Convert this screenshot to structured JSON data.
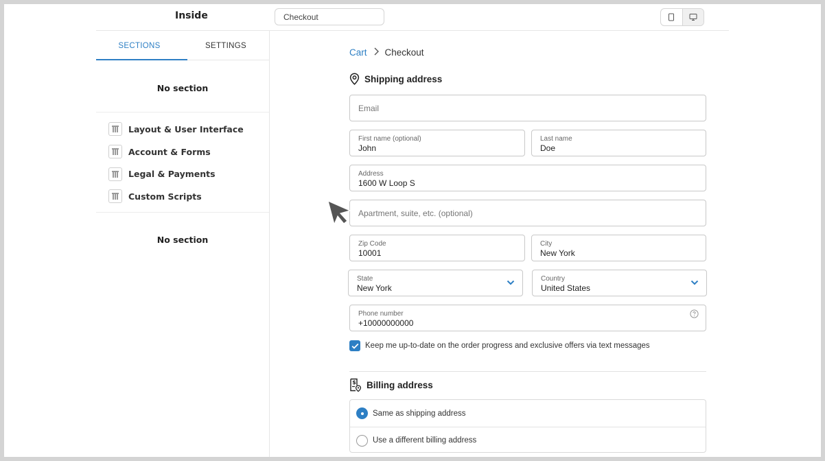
{
  "app": {
    "title": "Inside"
  },
  "page_selector": {
    "value": "Checkout"
  },
  "device_toggle": {
    "options": [
      "tablet-icon",
      "desktop-icon"
    ],
    "active": "desktop-icon"
  },
  "sidebar": {
    "tabs": [
      {
        "label": "SECTIONS",
        "active": true
      },
      {
        "label": "SETTINGS",
        "active": false
      }
    ],
    "empty_top": "No section",
    "items": [
      {
        "label": "Layout & User Interface",
        "icon": "section-icon"
      },
      {
        "label": "Account & Forms",
        "icon": "section-icon"
      },
      {
        "label": "Legal & Payments",
        "icon": "section-icon"
      },
      {
        "label": "Custom Scripts",
        "icon": "section-icon"
      }
    ],
    "empty_bottom": "No section"
  },
  "checkout": {
    "breadcrumb": {
      "link": "Cart",
      "separator_icon": "chevron-right-icon",
      "current": "Checkout"
    },
    "shipping": {
      "title": "Shipping address",
      "icon": "location-pin-icon",
      "email": {
        "placeholder": "Email",
        "value": ""
      },
      "first_name": {
        "label": "First name (optional)",
        "value": "John"
      },
      "last_name": {
        "label": "Last name",
        "value": "Doe"
      },
      "address": {
        "label": "Address",
        "value": "1600 W Loop S"
      },
      "apartment": {
        "placeholder": "Apartment, suite, etc. (optional)",
        "value": ""
      },
      "zip": {
        "label": "Zip Code",
        "value": "10001"
      },
      "city": {
        "label": "City",
        "value": "New York"
      },
      "state": {
        "label": "State",
        "value": "New York"
      },
      "country": {
        "label": "Country",
        "value": "United States"
      },
      "phone": {
        "label": "Phone number",
        "value": "+10000000000",
        "help_icon": "question-circle-icon"
      },
      "sms_optin": {
        "label": "Keep me up-to-date on the order progress and exclusive offers via text messages",
        "checked": true
      }
    },
    "billing": {
      "title": "Billing address",
      "icon": "billing-doc-icon",
      "options": [
        {
          "label": "Same as shipping address",
          "selected": true
        },
        {
          "label": "Use a different billing address",
          "selected": false
        }
      ]
    }
  },
  "colors": {
    "accent": "#2d7fc4",
    "border": "#c8c8c8",
    "frame": "#d4d4d4"
  }
}
